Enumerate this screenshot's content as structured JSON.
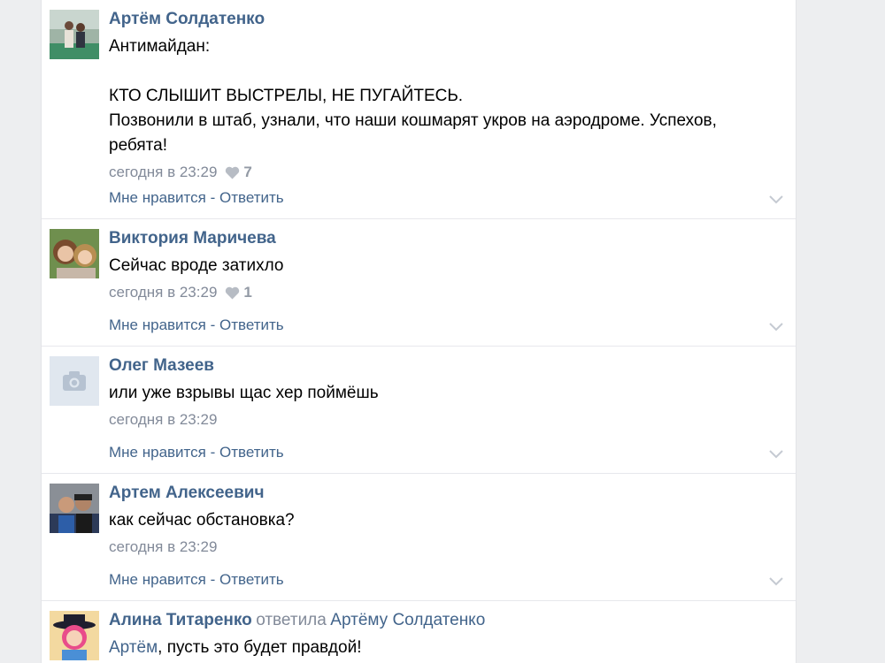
{
  "actions": {
    "like": "Мне нравится",
    "separator": " - ",
    "reply": "Ответить"
  },
  "colors": {
    "link": "#42648b",
    "meta": "#828a99",
    "divider": "#e7e8ec"
  },
  "comments": [
    {
      "author": "Артём Солдатенко",
      "text": "Антимайдан:\n\nКТО СЛЫШИТ ВЫСТРЕЛЫ, НЕ ПУГАЙТЕСЬ.\nПозвонили в штаб, узнали, что наши кошмарят укров на аэродроме. Успехов, ребята!",
      "time": "сегодня в 23:29",
      "likes": "7",
      "avatar": "photo-two-people-icon"
    },
    {
      "author": "Виктория Маричева",
      "text": "Сейчас вроде затихло",
      "time": "сегодня в 23:29",
      "likes": "1",
      "avatar": "photo-two-girls-icon"
    },
    {
      "author": "Олег Мазеев",
      "text": "или уже взрывы щас хер поймёшь",
      "time": "сегодня в 23:29",
      "avatar": "camera-placeholder-icon"
    },
    {
      "author": "Артем Алексеевич",
      "text": "как сейчас обстановка?",
      "time": "сегодня в 23:29",
      "avatar": "photo-two-men-icon"
    },
    {
      "author": "Алина Титаренко",
      "reply_word": "ответила",
      "reply_to": "Артёму Солдатенко",
      "mention": "Артём",
      "text": ", пусть это будет правдой!",
      "avatar": "cartoon-girl-icon"
    }
  ]
}
